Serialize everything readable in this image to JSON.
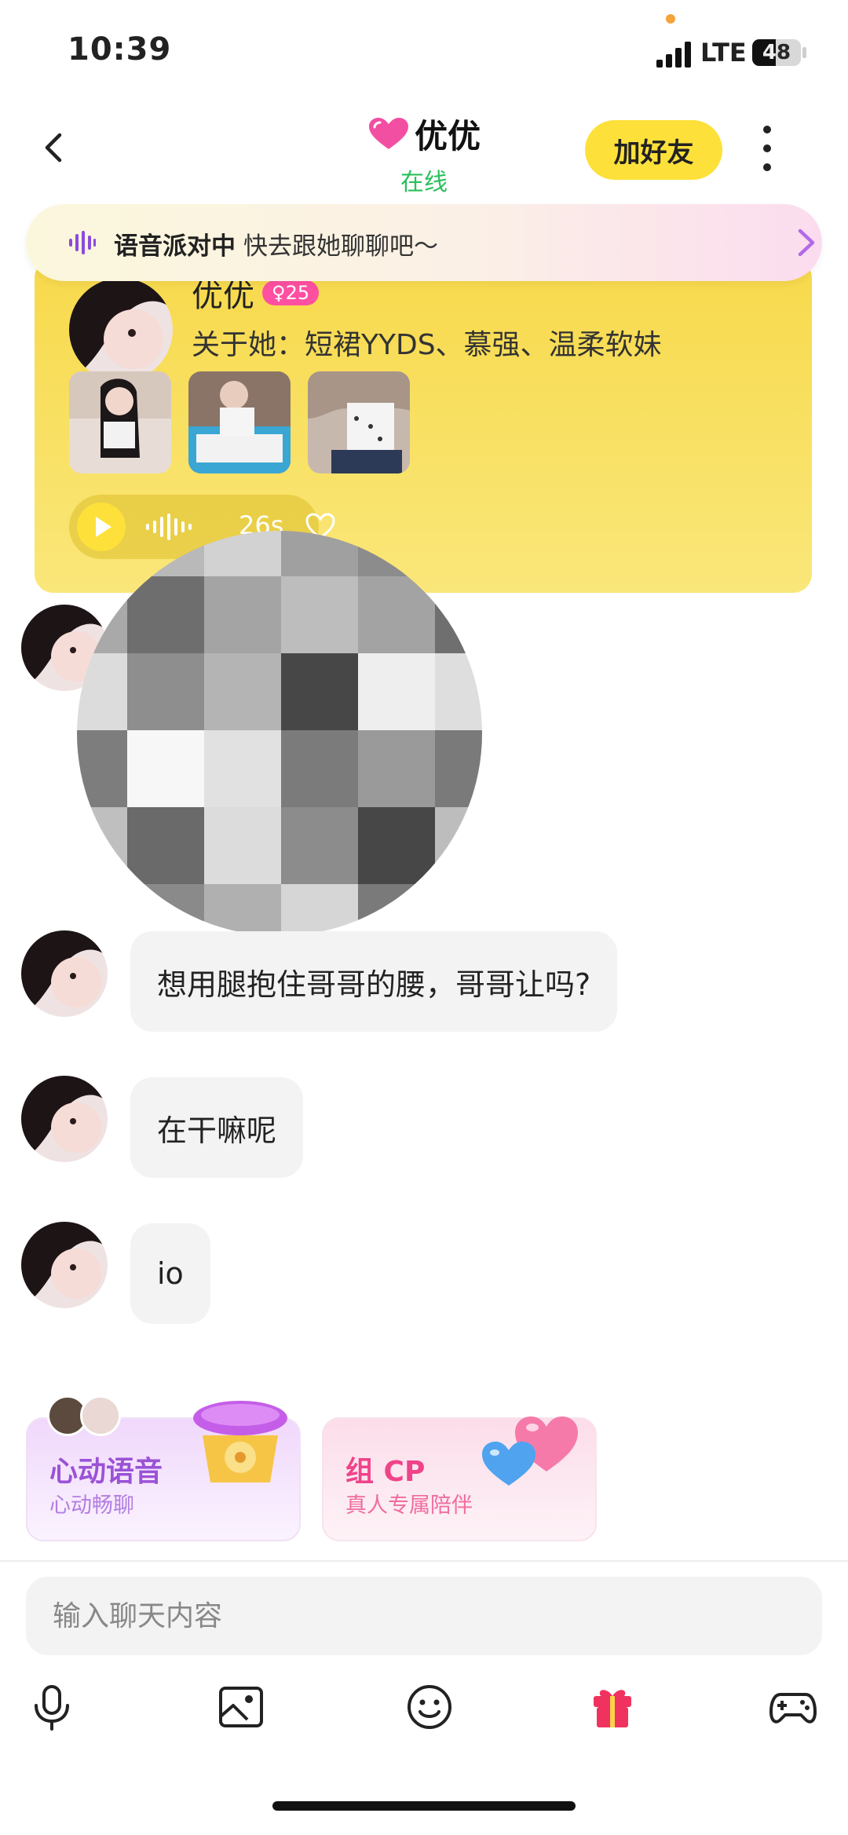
{
  "status_bar": {
    "time": "10:39",
    "network": "LTE",
    "battery": "48",
    "battery_level": 0.48
  },
  "header": {
    "title": "优优",
    "status": "在线",
    "add_friend_label": "加好友"
  },
  "banner": {
    "bold": "语音派对中",
    "text": "快去跟她聊聊吧～"
  },
  "profile_card": {
    "name": "优优",
    "badge": "♀25",
    "about": "关于她：短裙YYDS、慕强、温柔软妹",
    "voice_duration": "26s"
  },
  "messages": [
    {
      "text": "想用腿抱住哥哥的腰，哥哥让吗?"
    },
    {
      "text": "在干嘛呢"
    },
    {
      "text": "io"
    }
  ],
  "promos": [
    {
      "title": "心动语音",
      "subtitle": "心动畅聊"
    },
    {
      "title": "组 CP",
      "subtitle": "真人专属陪伴"
    }
  ],
  "composer": {
    "placeholder": "输入聊天内容"
  },
  "colors": {
    "accent_yellow": "#fde13a",
    "online_green": "#29c05a",
    "purple": "#9a52d6",
    "pink": "#f0438a"
  },
  "icons": [
    "back-icon",
    "more-icon",
    "sound-wave-icon",
    "chevron-right-icon",
    "play-icon",
    "heart-icon",
    "mic-icon",
    "image-icon",
    "emoji-icon",
    "gift-icon",
    "gamepad-icon"
  ]
}
